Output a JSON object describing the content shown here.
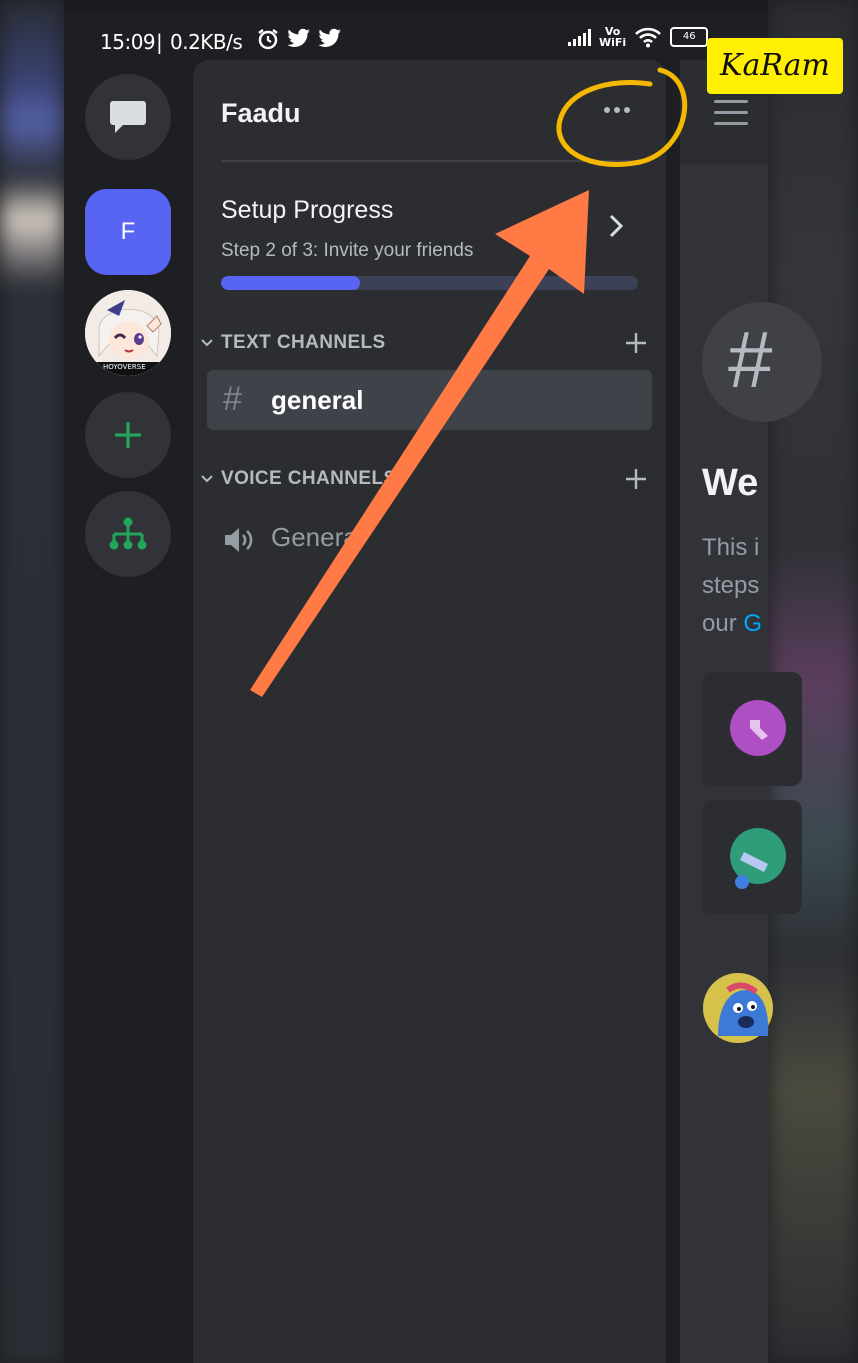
{
  "status_bar": {
    "time": "15:09",
    "network_speed": "0.2KB/s",
    "vowifi_top": "Vo",
    "vowifi_bottom": "WiFi",
    "battery": "46"
  },
  "watermark": "KaRam",
  "rail": {
    "dm_icon": "chat-bubble-icon",
    "server_initial": "F",
    "avatar_caption": "HOYOVERSE",
    "add_icon": "plus-icon",
    "discover_icon": "hierarchy-icon"
  },
  "server": {
    "name": "Faadu",
    "menu_icon": "more-dots-icon"
  },
  "setup": {
    "title": "Setup Progress",
    "step_text": "Step 2 of 3: Invite your friends",
    "progress_fraction": 0.333
  },
  "categories": {
    "text": {
      "label": "TEXT CHANNELS"
    },
    "voice": {
      "label": "VOICE CHANNELS"
    }
  },
  "channels": {
    "text": [
      {
        "symbol": "#",
        "name": "general"
      }
    ],
    "voice": [
      {
        "name": "General"
      }
    ]
  },
  "main_peek": {
    "hash_symbol": "#",
    "welcome_partial": "We",
    "desc_line1": "This i",
    "desc_line2": "steps",
    "desc_line3_prefix": "our ",
    "desc_line3_link": "G"
  },
  "colors": {
    "accent": "#5865f2",
    "add_green": "#23a55a",
    "annotation_arrow": "#ff7a45",
    "annotation_circle": "#f5b800"
  }
}
